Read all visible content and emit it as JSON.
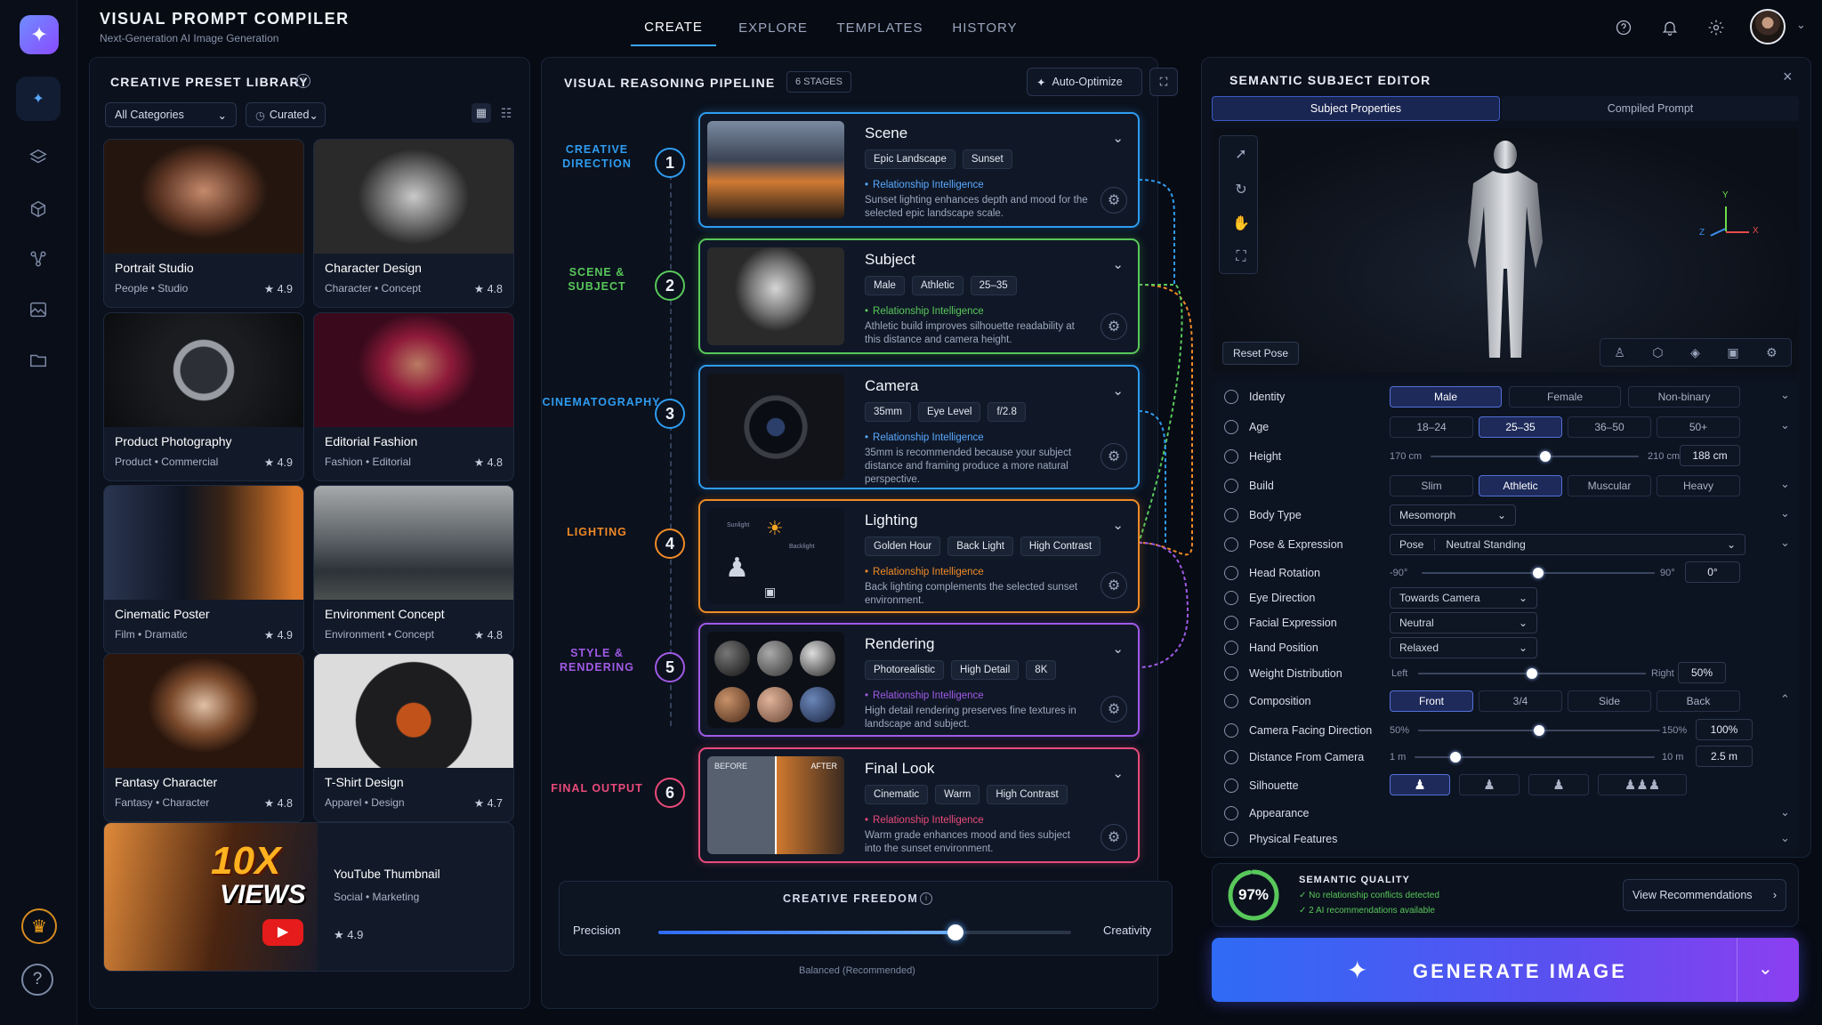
{
  "header": {
    "title": "VISUAL PROMPT COMPILER",
    "subtitle": "Next-Generation AI Image Generation",
    "nav": [
      "CREATE",
      "EXPLORE",
      "TEMPLATES",
      "HISTORY"
    ]
  },
  "library": {
    "title": "CREATIVE PRESET LIBRARY",
    "filter_category": "All Categories",
    "filter_sort": "Curated",
    "cards": [
      {
        "name": "Portrait Studio",
        "meta": "People • Studio",
        "rating": "4.9"
      },
      {
        "name": "Character Design",
        "meta": "Character • Concept",
        "rating": "4.8"
      },
      {
        "name": "Product Photography",
        "meta": "Product • Commercial",
        "rating": "4.9"
      },
      {
        "name": "Editorial Fashion",
        "meta": "Fashion • Editorial",
        "rating": "4.8"
      },
      {
        "name": "Cinematic Poster",
        "meta": "Film • Dramatic",
        "rating": "4.9"
      },
      {
        "name": "Environment Concept",
        "meta": "Environment • Concept",
        "rating": "4.8"
      },
      {
        "name": "Fantasy Character",
        "meta": "Fantasy • Character",
        "rating": "4.8"
      },
      {
        "name": "T-Shirt Design",
        "meta": "Apparel • Design",
        "rating": "4.7"
      }
    ],
    "featured": {
      "name": "YouTube Thumbnail",
      "meta": "Social • Marketing",
      "rating": "4.9",
      "thumb_line1": "10X",
      "thumb_line2": "VIEWS"
    }
  },
  "pipeline": {
    "title": "VISUAL REASONING PIPELINE",
    "badge": "6 STAGES",
    "auto_optimize": "Auto-Optimize",
    "relationship_label": "Relationship Intelligence",
    "groups": [
      "CREATIVE DIRECTION",
      "SCENE & SUBJECT",
      "CINEMATOGRAPHY",
      "LIGHTING",
      "STYLE & RENDERING",
      "FINAL OUTPUT"
    ],
    "stages": [
      {
        "num": "1",
        "title": "Scene",
        "tags": [
          "Epic Landscape",
          "Sunset"
        ],
        "text": "Sunset lighting enhances depth and mood for the selected epic landscape scale.",
        "color": "#2e9cf0"
      },
      {
        "num": "2",
        "title": "Subject",
        "tags": [
          "Male",
          "Athletic",
          "25–35"
        ],
        "text": "Athletic build improves silhouette readability at this distance and camera height.",
        "color": "#58c85a"
      },
      {
        "num": "3",
        "title": "Camera",
        "tags": [
          "35mm",
          "Eye Level",
          "f/2.8"
        ],
        "text": "35mm is recommended because your subject distance and framing produce a more natural perspective.",
        "color": "#2e9cf0"
      },
      {
        "num": "4",
        "title": "Lighting",
        "tags": [
          "Golden Hour",
          "Back Light",
          "High Contrast"
        ],
        "text": "Back lighting complements the selected sunset environment.",
        "color": "#f08a26"
      },
      {
        "num": "5",
        "title": "Rendering",
        "tags": [
          "Photorealistic",
          "High Detail",
          "8K"
        ],
        "text": "High detail rendering preserves fine textures in landscape and subject.",
        "color": "#a05ae6"
      },
      {
        "num": "6",
        "title": "Final Look",
        "tags": [
          "Cinematic",
          "Warm",
          "High Contrast"
        ],
        "text": "Warm grade enhances mood and ties subject into the sunset environment.",
        "color": "#ea4a7a"
      }
    ],
    "lighting_labels": {
      "sunlight": "Sunlight",
      "backlight": "Backlight"
    },
    "final_labels": {
      "before": "BEFORE",
      "after": "AFTER"
    },
    "freedom": {
      "title": "CREATIVE FREEDOM",
      "left": "Precision",
      "right": "Creativity",
      "value": 0.72,
      "caption": "Balanced (Recommended)"
    }
  },
  "editor": {
    "title": "SEMANTIC SUBJECT EDITOR",
    "tabs": [
      "Subject Properties",
      "Compiled Prompt"
    ],
    "reset_pose": "Reset Pose",
    "axes": {
      "x": "X",
      "y": "Y",
      "z": "Z"
    },
    "rows": {
      "identity": {
        "label": "Identity",
        "options": [
          "Male",
          "Female",
          "Non-binary"
        ],
        "selected": 0
      },
      "age": {
        "label": "Age",
        "options": [
          "18–24",
          "25–35",
          "36–50",
          "50+"
        ],
        "selected": 1
      },
      "height": {
        "label": "Height",
        "min": "170 cm",
        "max": "210 cm",
        "value": "188 cm",
        "pos": 0.55
      },
      "build": {
        "label": "Build",
        "options": [
          "Slim",
          "Athletic",
          "Muscular",
          "Heavy"
        ],
        "selected": 1
      },
      "body_type": {
        "label": "Body Type",
        "value": "Mesomorph"
      },
      "pose": {
        "label": "Pose & Expression",
        "prefix": "Pose",
        "value": "Neutral Standing"
      },
      "head_rotation": {
        "label": "Head Rotation",
        "min": "-90°",
        "max": "90°",
        "value": "0°",
        "pos": 0.5
      },
      "eye_direction": {
        "label": "Eye Direction",
        "value": "Towards Camera"
      },
      "facial": {
        "label": "Facial Expression",
        "value": "Neutral"
      },
      "hand": {
        "label": "Hand Position",
        "value": "Relaxed"
      },
      "weight": {
        "label": "Weight Distribution",
        "min": "Left",
        "max": "Right",
        "value": "50%",
        "pos": 0.5
      },
      "composition": {
        "label": "Composition",
        "options": [
          "Front",
          "3/4",
          "Side",
          "Back"
        ],
        "selected": 0
      },
      "facing": {
        "label": "Camera Facing Direction",
        "min": "50%",
        "max": "150%",
        "value": "100%",
        "pos": 0.5
      },
      "distance": {
        "label": "Distance From Camera",
        "min": "1 m",
        "max": "10 m",
        "value": "2.5 m",
        "pos": 0.17
      },
      "silhouette": {
        "label": "Silhouette"
      },
      "appearance": {
        "label": "Appearance"
      },
      "physical": {
        "label": "Physical Features"
      }
    },
    "quality": {
      "score": "97%",
      "value": 0.97,
      "title": "SEMANTIC QUALITY",
      "line1": "No relationship conflicts detected",
      "line2": "2 AI recommendations available",
      "button": "View Recommendations"
    },
    "generate": "GENERATE IMAGE"
  },
  "colors": {
    "accent": "#3aa3ff",
    "generate_from": "#2f6bf5",
    "generate_to": "#8c3ff0"
  }
}
